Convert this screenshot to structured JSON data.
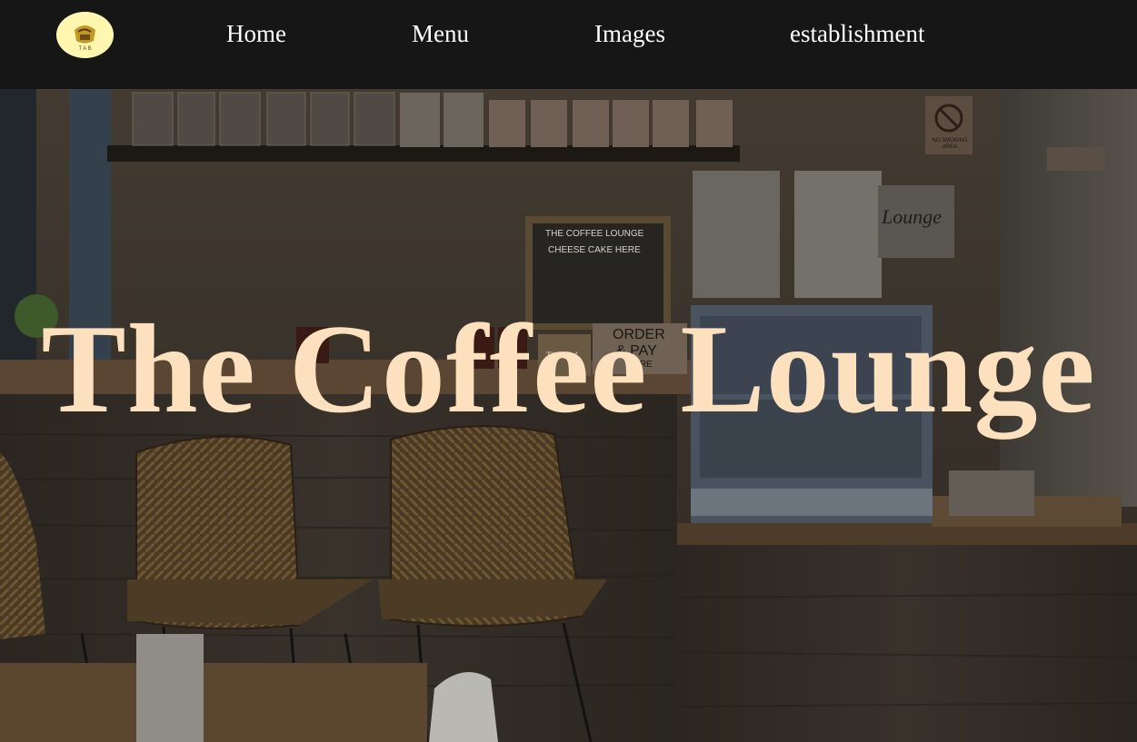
{
  "nav": {
    "logo_icon": "cafe-logo-icon",
    "links": [
      {
        "label": "Home"
      },
      {
        "label": "Menu"
      },
      {
        "label": "Images"
      },
      {
        "label": "establishment"
      }
    ]
  },
  "hero": {
    "title": "The Coffee Lounge",
    "background_image": "dimmed cafe counter interior with rattan bar stools",
    "letterboard_lines": [
      "THE COFFEE LOUNGE",
      "CHEESE CAKE HERE"
    ],
    "order_sign": [
      "ORDER",
      "& PAY",
      "HERE"
    ],
    "tip_sign": "Tip Us!",
    "no_smoking_sign": "NO SMOKING AREA",
    "wall_sign": "Lounge"
  },
  "colors": {
    "navbar": "#161616",
    "nav_text": "#ffffff",
    "logo_bg": "#fff7b0",
    "hero_title": "#fde0bd"
  }
}
